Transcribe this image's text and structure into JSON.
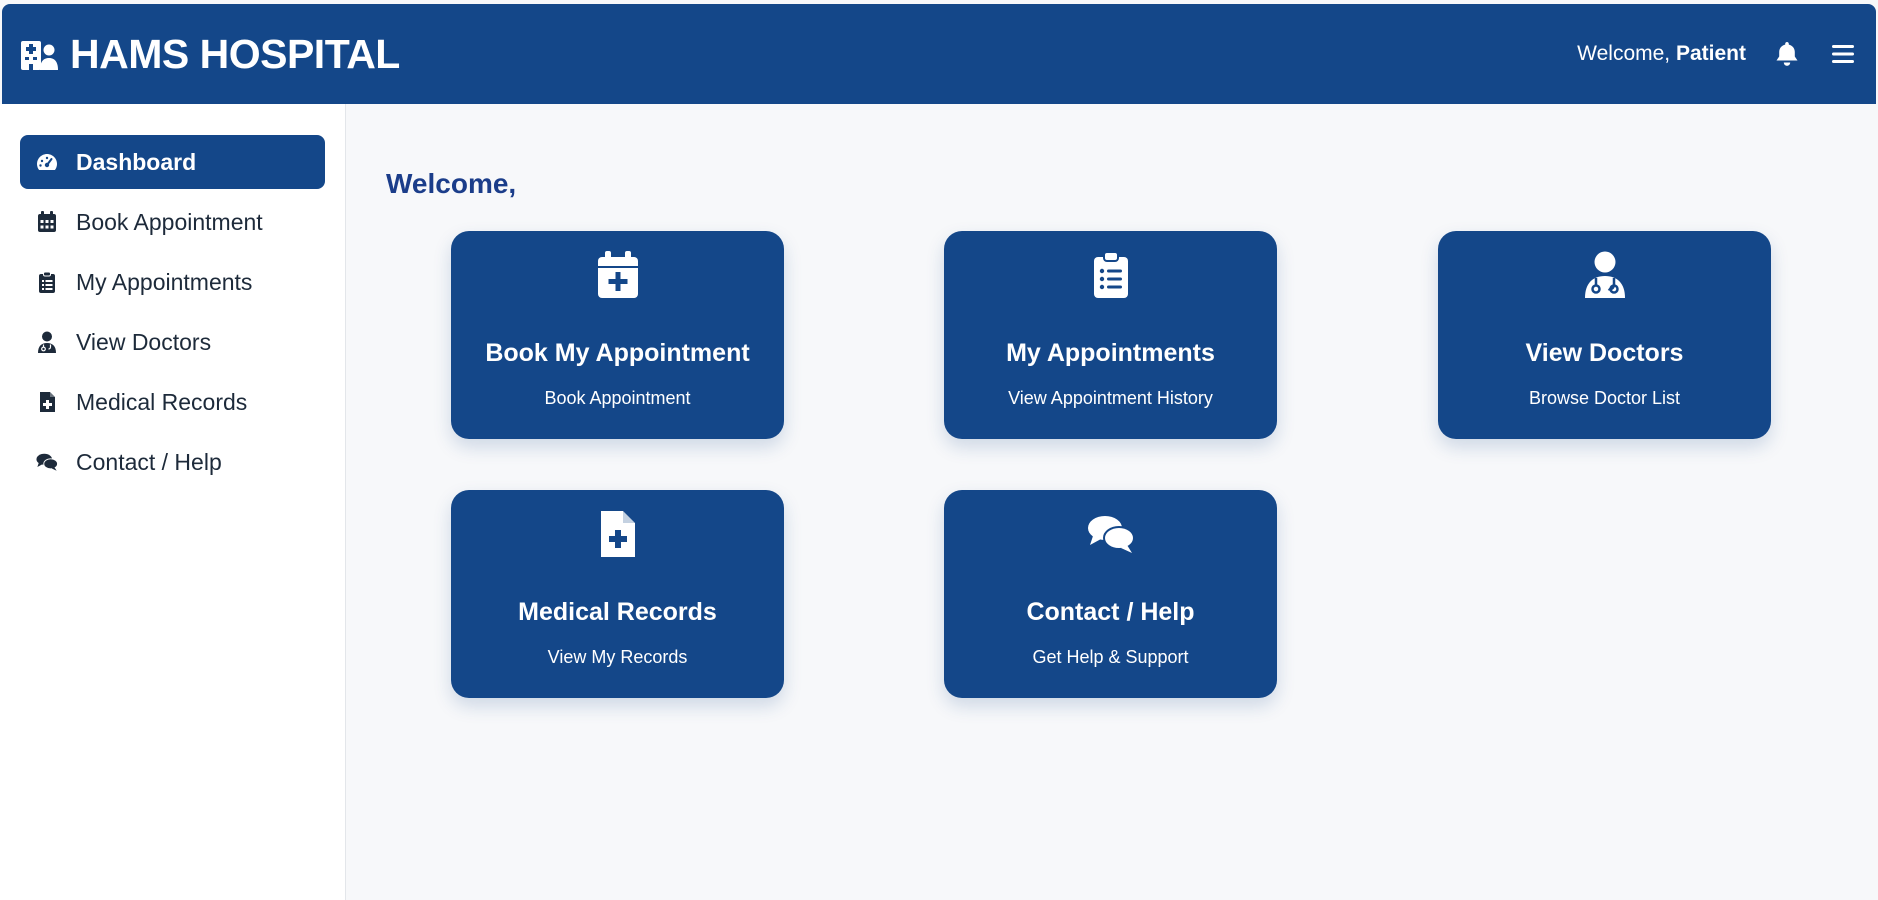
{
  "header": {
    "title": "HAMS HOSPITAL",
    "welcome_prefix": "Welcome,",
    "user_name": "Patient",
    "brand_color": "#144789"
  },
  "sidebar": {
    "items": [
      {
        "label": "Dashboard",
        "icon": "gauge-icon",
        "active": true
      },
      {
        "label": "Book Appointment",
        "icon": "calendar-icon",
        "active": false
      },
      {
        "label": "My Appointments",
        "icon": "clipboard-list-icon",
        "active": false
      },
      {
        "label": "View Doctors",
        "icon": "doctor-icon",
        "active": false
      },
      {
        "label": "Medical Records",
        "icon": "file-medical-icon",
        "active": false
      },
      {
        "label": "Contact / Help",
        "icon": "comments-icon",
        "active": false
      }
    ]
  },
  "main": {
    "greeting": "Welcome,",
    "cards": [
      {
        "title": "Book My Appointment",
        "subtitle": "Book Appointment",
        "icon": "calendar-plus-icon"
      },
      {
        "title": "My Appointments",
        "subtitle": "View Appointment History",
        "icon": "clipboard-list-icon"
      },
      {
        "title": "View Doctors",
        "subtitle": "Browse Doctor List",
        "icon": "doctor-icon"
      },
      {
        "title": "Medical Records",
        "subtitle": "View My Records",
        "icon": "file-medical-icon"
      },
      {
        "title": "Contact / Help",
        "subtitle": "Get Help & Support",
        "icon": "comments-icon"
      }
    ]
  }
}
